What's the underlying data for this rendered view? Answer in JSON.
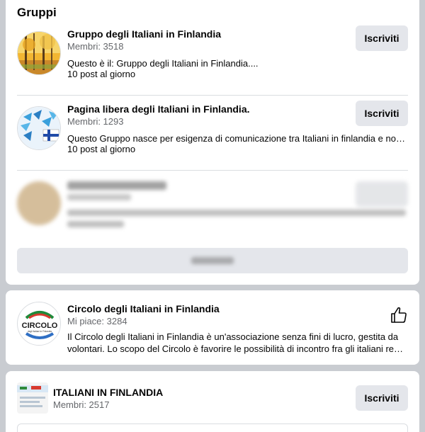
{
  "groups_section": {
    "title": "Gruppi",
    "items": [
      {
        "name": "Gruppo degli Italiani in Finlandia",
        "members": "Membri: 3518",
        "description": "Questo è il: Gruppo degli Italiani in Finlandia....",
        "activity": "10 post al giorno",
        "button": "Iscriviti",
        "avatar_icon": "autumn-forest-photo"
      },
      {
        "name": "Pagina libera degli Italiani in Finlandia.",
        "members": "Membri: 1293",
        "description": "Questo Gruppo nasce per esigenza di comunicazione tra Italiani in finlandia e non....",
        "activity": "10 post al giorno",
        "button": "Iscriviti",
        "avatar_icon": "butterflies-finland-flag"
      }
    ]
  },
  "page_card": {
    "name": "Circolo degli Italiani in Finlandia",
    "likes": "Mi piace: 3284",
    "description_line1": "Il Circolo degli Italiani in Finlandia è un'associazione senza fini di lucro, gestita da",
    "description_line2": "volontari. Lo scopo del Circolo è favorire le possibilità di incontro fra gli italiani resi...",
    "logo_text": "CIRCOLO",
    "logo_subtext": "degli Italiani in Finlandia",
    "like_icon": "thumbs-up-icon"
  },
  "group_card_2": {
    "name": "ITALIANI IN FINLANDIA",
    "members": "Membri: 2517",
    "button": "Iscriviti"
  },
  "colors": {
    "page_bg": "#c9ccd1",
    "button_bg": "#e4e6eb",
    "secondary_text": "#65676b"
  }
}
